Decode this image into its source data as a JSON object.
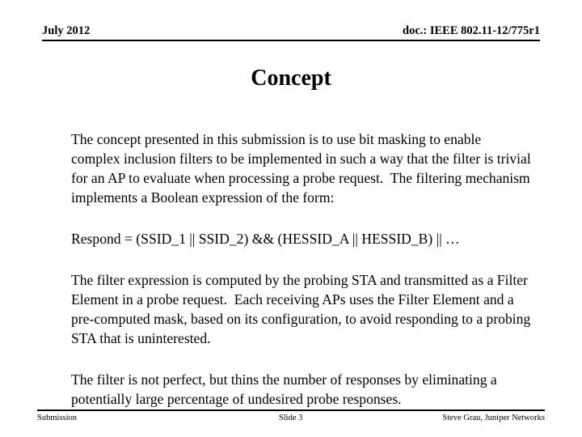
{
  "header": {
    "left": "July 2012",
    "right": "doc.: IEEE 802.11-12/775r1"
  },
  "title": "Concept",
  "body": {
    "paragraph_1": "The concept presented in this submission is to use bit masking to enable complex inclusion filters to be implemented in such a way that the filter is trivial for an AP to evaluate when processing a probe request.  The filtering mechanism implements a Boolean expression of the form:",
    "expression": "Respond = (SSID_1 || SSID_2) && (HESSID_A || HESSID_B) || …",
    "paragraph_2": "The filter expression is computed by the probing STA and transmitted as a Filter Element in a probe request.  Each receiving APs uses the Filter Element and a pre-computed mask, based on its configuration, to avoid responding to a probing STA that is uninterested.",
    "paragraph_3": "The filter is not perfect, but thins the number of responses by eliminating a potentially large percentage of undesired probe responses."
  },
  "footer": {
    "left": "Submission",
    "center": "Slide 3",
    "right": "Steve Grau, Juniper Networks"
  },
  "colors": {
    "text": "#000000",
    "background": "#ffffff",
    "rule": "#000000"
  }
}
